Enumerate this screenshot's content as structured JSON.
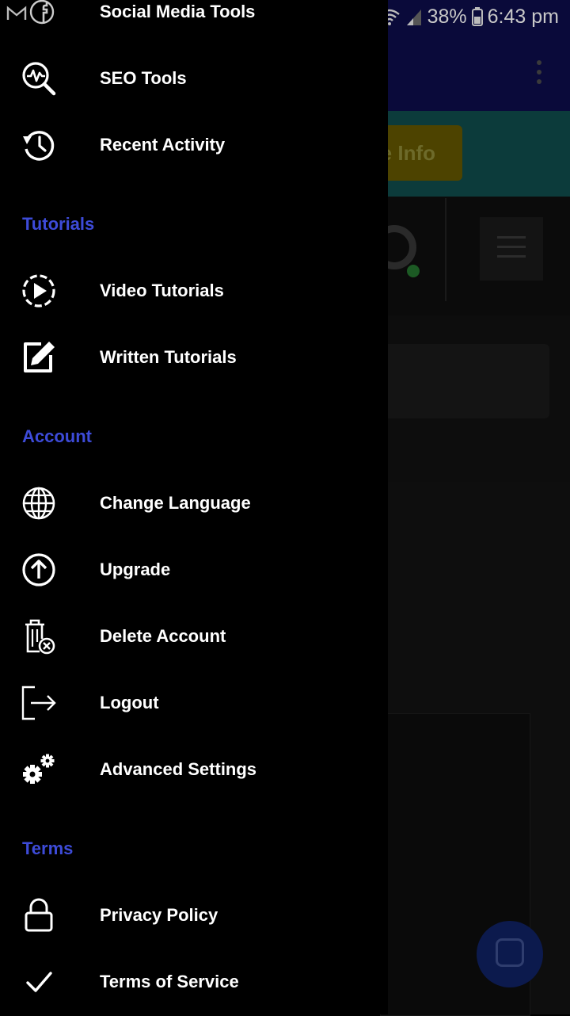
{
  "status_bar": {
    "battery_percent": "38%",
    "time": "6:43 pm",
    "notification_icons": [
      "gmail-icon",
      "facebook-icon"
    ]
  },
  "background_app": {
    "button_partial_label": "e Info"
  },
  "drawer": {
    "top_items": [
      {
        "label": "Social Media Tools",
        "icon": "social-icon"
      },
      {
        "label": "SEO Tools",
        "icon": "seo-search-icon"
      },
      {
        "label": "Recent Activity",
        "icon": "history-icon"
      }
    ],
    "sections": [
      {
        "title": "Tutorials",
        "items": [
          {
            "label": "Video Tutorials",
            "icon": "play-circle-icon"
          },
          {
            "label": "Written Tutorials",
            "icon": "edit-icon"
          }
        ]
      },
      {
        "title": "Account",
        "items": [
          {
            "label": "Change Language",
            "icon": "globe-icon"
          },
          {
            "label": "Upgrade",
            "icon": "arrow-up-circle-icon"
          },
          {
            "label": "Delete Account",
            "icon": "trash-x-icon"
          },
          {
            "label": "Logout",
            "icon": "logout-icon"
          },
          {
            "label": "Advanced Settings",
            "icon": "gears-icon"
          }
        ]
      },
      {
        "title": "Terms",
        "items": [
          {
            "label": "Privacy Policy",
            "icon": "lock-icon"
          },
          {
            "label": "Terms of Service",
            "icon": "checkmark-icon"
          }
        ]
      }
    ]
  },
  "colors": {
    "section_header": "#3d4bd8",
    "drawer_background": "#000000",
    "text": "#ffffff"
  }
}
